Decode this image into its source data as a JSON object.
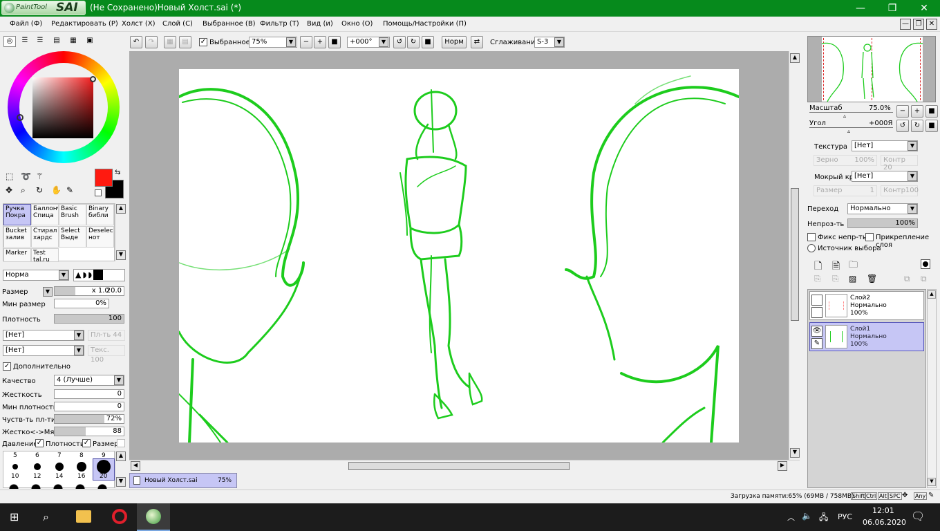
{
  "window": {
    "title": "(Не Сохранено)Новый Холст.sai (*)",
    "logo_small": "PaintTool",
    "logo_big": "SAI",
    "minimize": "—",
    "maximize": "❐",
    "close": "✕"
  },
  "menu": [
    "Файл (Ф)",
    "Редактировать (Р)",
    "Холст (Х)",
    "Слой (С)",
    "Выбранное (В)",
    "Фильтр (Т)",
    "Вид (и)",
    "Окно (О)",
    "Помощь/Настройки (П)"
  ],
  "toolbar": {
    "selected_label": "Выбранное",
    "zoom": "75%",
    "angle": "+000°",
    "norm": "Норм",
    "smoothing_label": "Сглаживание",
    "smoothing": "S-3"
  },
  "left": {
    "tools": [
      {
        "l1": "Ручка",
        "l2": "Покра"
      },
      {
        "l1": "Баллонч",
        "l2": "Спица"
      },
      {
        "l1": "Basic",
        "l2": "Brush"
      },
      {
        "l1": "Binary",
        "l2": "библи"
      },
      {
        "l1": "Bucket",
        "l2": "залив"
      },
      {
        "l1": "Стирал",
        "l2": "хардс"
      },
      {
        "l1": "Select",
        "l2": "Выде"
      },
      {
        "l1": "Deselect",
        "l2": "нот"
      },
      {
        "l1": "Marker",
        "l2": ""
      },
      {
        "l1": "Test",
        "l2": "tal.ru"
      }
    ],
    "blend_mode": "Норма",
    "size_label": "Размер",
    "size_mult": "x 1.0",
    "size_value": "20.0",
    "min_size_label": "Мин размер",
    "min_size_value": "0%",
    "density_label": "Плотность",
    "density_value": "100",
    "none1": "[Нет]",
    "none2": "[Нет]",
    "pl_label": "Пл-ть 44",
    "tex_label": "Текс. 100",
    "extra_label": "Дополнительно",
    "quality_label": "Качество",
    "quality_value": "4 (Лучше)",
    "hardness_label": "Жесткость",
    "hardness_value": "0",
    "min_density_label": "Мин плотность",
    "min_density_value": "0",
    "sens_label": "Чуств-ть пл-ти",
    "sens_value": "72%",
    "soft_label": "Жестко<->Мягко",
    "soft_value": "88",
    "pressure_label": "Давление:",
    "pressure_density": "Плотность",
    "pressure_size": "Размер",
    "brush_sizes_top": [
      "5",
      "6",
      "7",
      "8",
      "9"
    ],
    "brush_sizes_bottom": [
      "10",
      "12",
      "14",
      "16",
      "20"
    ]
  },
  "right": {
    "scale_label": "Масштаб",
    "scale_value": "75.0%",
    "angle_label": "Угол",
    "angle_value": "+000Я",
    "texture_label": "Текстура",
    "texture_value": "[Нет]",
    "grain_label": "Зерно",
    "grain_value": "100%",
    "contrast_label": "Контр 20",
    "wet_label": "Мокрый край",
    "wet_value": "[Нет]",
    "wsize_label": "Размер",
    "wsize_value": "1",
    "wcontrast_label": "Контр100",
    "blend_label": "Переход",
    "blend_value": "Нормально",
    "opacity_label": "Непроз-ть",
    "opacity_value": "100%",
    "fix_label": "Фикс непр-ть",
    "clip_label": "Прикрепление слоя",
    "source_label": "Источник выбора",
    "layers": [
      {
        "name": "Слой2",
        "mode": "Нормально",
        "opacity": "100%"
      },
      {
        "name": "Слой1",
        "mode": "Нормально",
        "opacity": "100%"
      }
    ]
  },
  "doc_tab": {
    "name": "Новый Холст.sai",
    "zoom": "75%"
  },
  "status": {
    "memory": "Загрузка памяти:65% (69MB / 758MB)",
    "keys": [
      "Shift",
      "Ctrl",
      "Alt",
      "SPC",
      "Any"
    ]
  },
  "taskbar": {
    "lang": "РУС",
    "time": "12:01",
    "date": "06.06.2020"
  },
  "colors": {
    "title_green": "#068a1c",
    "stroke_green": "#1dcc1d",
    "primary": "#ff1a10",
    "secondary": "#000000",
    "selection": "#c6c6f5"
  }
}
